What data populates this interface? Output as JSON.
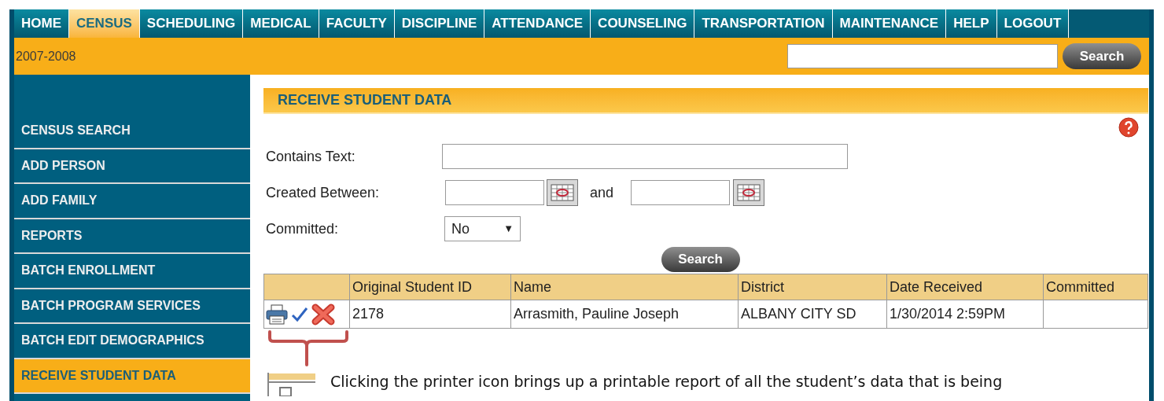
{
  "nav": {
    "tabs": [
      {
        "label": "HOME",
        "selected": false
      },
      {
        "label": "CENSUS",
        "selected": true
      },
      {
        "label": "SCHEDULING",
        "selected": false
      },
      {
        "label": "MEDICAL",
        "selected": false
      },
      {
        "label": "FACULTY",
        "selected": false
      },
      {
        "label": "DISCIPLINE",
        "selected": false
      },
      {
        "label": "ATTENDANCE",
        "selected": false
      },
      {
        "label": "COUNSELING",
        "selected": false
      },
      {
        "label": "TRANSPORTATION",
        "selected": false
      },
      {
        "label": "MAINTENANCE",
        "selected": false
      },
      {
        "label": "HELP",
        "selected": false
      },
      {
        "label": "LOGOUT",
        "selected": false
      }
    ]
  },
  "school_year": "2007-2008",
  "global_search": {
    "button": "Search"
  },
  "sidebar": {
    "items": [
      {
        "label": "CENSUS SEARCH",
        "selected": false
      },
      {
        "label": "ADD PERSON",
        "selected": false
      },
      {
        "label": "ADD FAMILY",
        "selected": false
      },
      {
        "label": "REPORTS",
        "selected": false
      },
      {
        "label": "BATCH ENROLLMENT",
        "selected": false
      },
      {
        "label": "BATCH PROGRAM SERVICES",
        "selected": false
      },
      {
        "label": "BATCH EDIT DEMOGRAPHICS",
        "selected": false
      },
      {
        "label": "RECEIVE STUDENT DATA",
        "selected": true
      }
    ]
  },
  "page_title": "RECEIVE STUDENT DATA",
  "form": {
    "contains_text": {
      "label": "Contains Text:"
    },
    "created_between": {
      "label": "Created Between:",
      "joiner": "and"
    },
    "committed": {
      "label": "Committed:",
      "value": "No",
      "caret": "▼"
    },
    "search_button": "Search"
  },
  "table": {
    "columns": [
      "Original Student ID",
      "Name",
      "District",
      "Date Received",
      "Committed"
    ],
    "rows": [
      {
        "cells": [
          "2178",
          "Arrasmith, Pauline Joseph",
          "ALBANY CITY SD",
          "1/30/2014 2:59PM"
        ]
      }
    ]
  },
  "caption": "Clicking the printer icon brings up a printable report of all the student’s data that is being"
}
